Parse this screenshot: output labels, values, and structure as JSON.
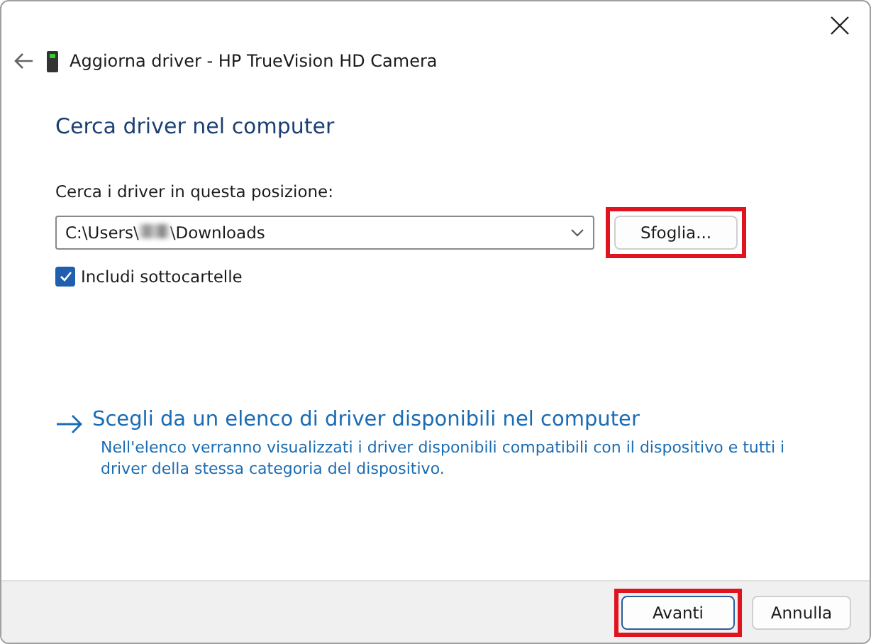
{
  "window": {
    "title": "Aggiorna driver - HP TrueVision HD Camera"
  },
  "heading": "Cerca driver nel computer",
  "location": {
    "label": "Cerca i driver in questa posizione:",
    "path_start": "C:\\Users\\",
    "path_end": "\\Downloads",
    "redacted": true,
    "browse": {
      "label": "Sfoglia...",
      "highlighted": true
    }
  },
  "include_subfolders": {
    "label": "Includi sottocartelle",
    "checked": true
  },
  "pick_option": {
    "title": "Scegli da un elenco di driver disponibili nel computer",
    "description": "Nell'elenco verranno visualizzati i driver disponibili compatibili con il dispositivo e tutti i driver della stessa categoria del dispositivo."
  },
  "buttons": [
    {
      "label": "Avanti",
      "default": true,
      "highlighted": true
    },
    {
      "label": "Annulla",
      "default": false,
      "highlighted": false
    }
  ]
}
